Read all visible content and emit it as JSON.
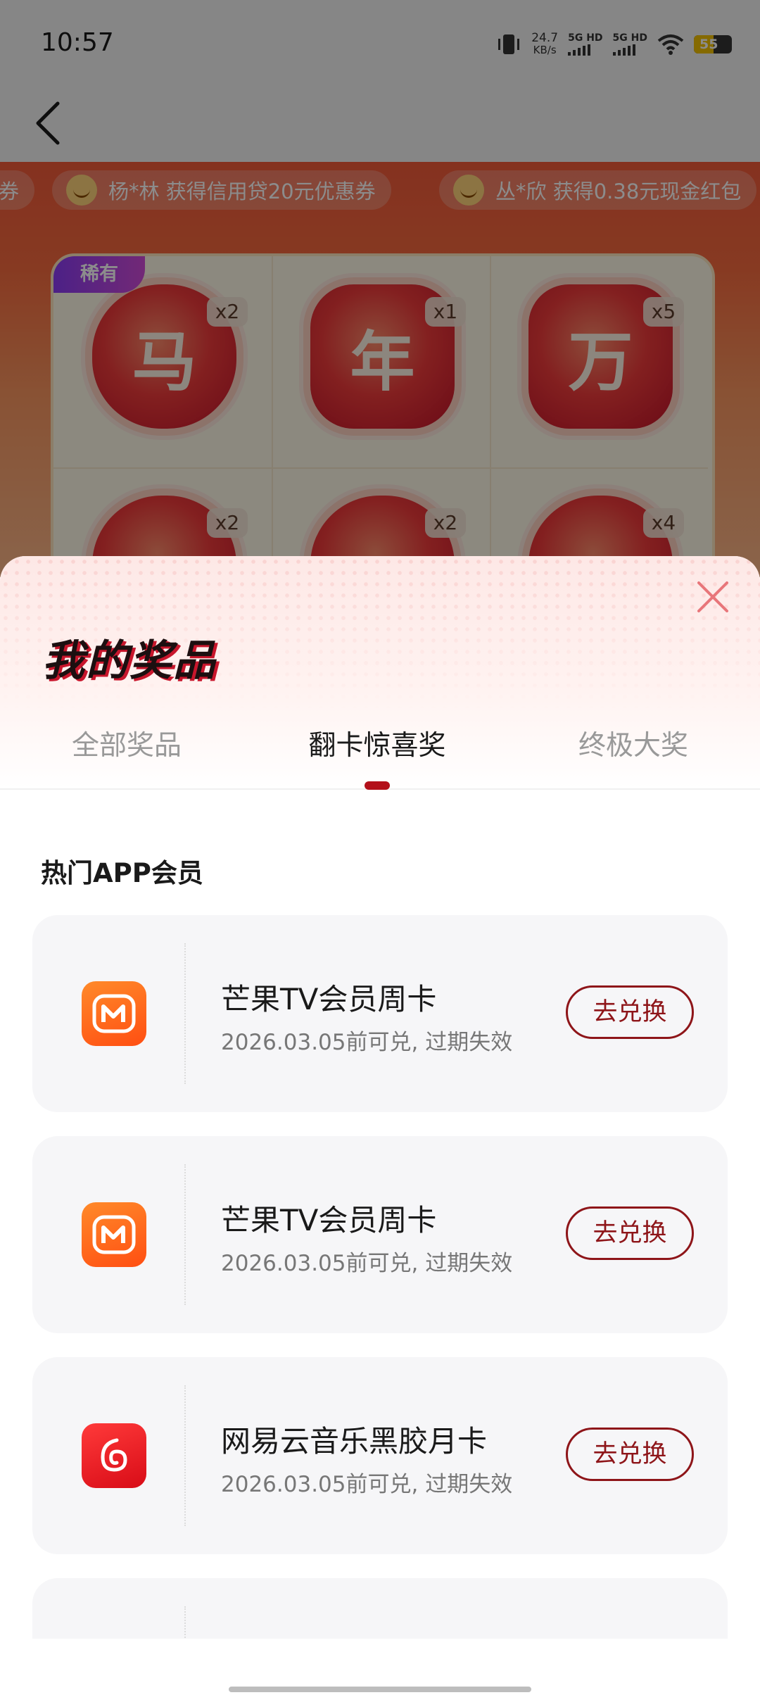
{
  "status_bar": {
    "time": "10:57",
    "net_speed_value": "24.7",
    "net_speed_unit": "KB/s",
    "sim1": "5G HD",
    "sim2": "5G HD",
    "battery": "55"
  },
  "ticker": {
    "items": [
      {
        "text": "券"
      },
      {
        "text": "杨*林 获得信用贷20元优惠券"
      },
      {
        "text": "丛*欣 获得0.38元现金红包"
      }
    ]
  },
  "card_board": {
    "rare_tag": "稀有",
    "tiles": [
      {
        "char": "马",
        "count": "x2"
      },
      {
        "char": "年",
        "count": "x1"
      },
      {
        "char": "万",
        "count": "x5"
      },
      {
        "char": "",
        "count": "x2"
      },
      {
        "char": "",
        "count": "x2"
      },
      {
        "char": "",
        "count": "x4"
      }
    ]
  },
  "sheet": {
    "title": "我的奖品",
    "tabs": [
      {
        "label": "全部奖品",
        "active": false
      },
      {
        "label": "翻卡惊喜奖",
        "active": true
      },
      {
        "label": "终极大奖",
        "active": false
      }
    ],
    "section_title": "热门APP会员",
    "prizes": [
      {
        "icon": "mango-tv-icon",
        "name": "芒果TV会员周卡",
        "expiry": "2026.03.05前可兑, 过期失效",
        "button": "去兑换"
      },
      {
        "icon": "mango-tv-icon",
        "name": "芒果TV会员周卡",
        "expiry": "2026.03.05前可兑, 过期失效",
        "button": "去兑换"
      },
      {
        "icon": "netease-music-icon",
        "name": "网易云音乐黑胶月卡",
        "expiry": "2026.03.05前可兑, 过期失效",
        "button": "去兑换"
      }
    ]
  },
  "colors": {
    "accent": "#8e1519",
    "tab_indicator": "#b3101a",
    "card_bg": "#f6f6f8"
  }
}
